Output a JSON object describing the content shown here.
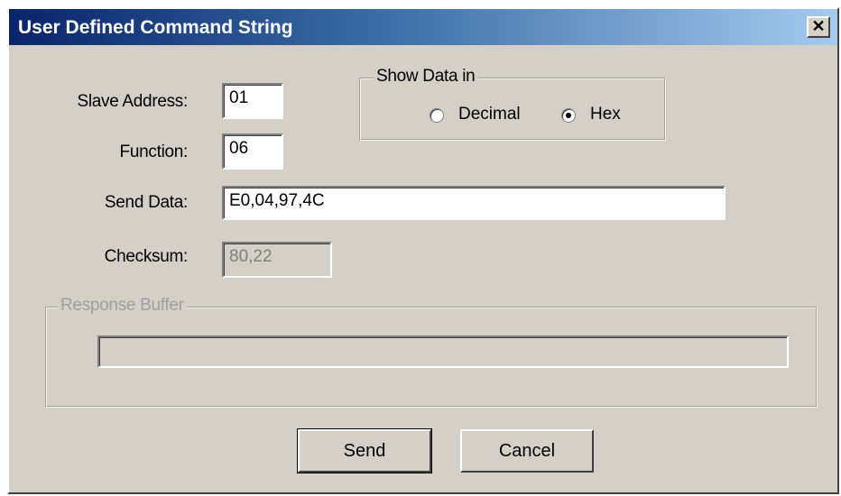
{
  "window": {
    "title": "User Defined Command String",
    "close_glyph": "✕"
  },
  "fields": {
    "slave_address": {
      "label": "Slave Address:",
      "value": "01"
    },
    "function": {
      "label": "Function:",
      "value": "06"
    },
    "send_data": {
      "label": "Send Data:",
      "value": "E0,04,97,4C"
    },
    "checksum": {
      "label": "Checksum:",
      "value": "80,22",
      "disabled": true
    }
  },
  "show_data_in": {
    "legend": "Show Data in",
    "options": [
      {
        "label": "Decimal",
        "selected": false
      },
      {
        "label": "Hex",
        "selected": true
      }
    ]
  },
  "response_buffer": {
    "legend": "Response Buffer",
    "value": "",
    "disabled": true
  },
  "buttons": {
    "send": "Send",
    "cancel": "Cancel"
  },
  "colors": {
    "dialog_bg": "#d4d0c8",
    "title_start": "#0a246a",
    "title_end": "#a6caf0"
  }
}
